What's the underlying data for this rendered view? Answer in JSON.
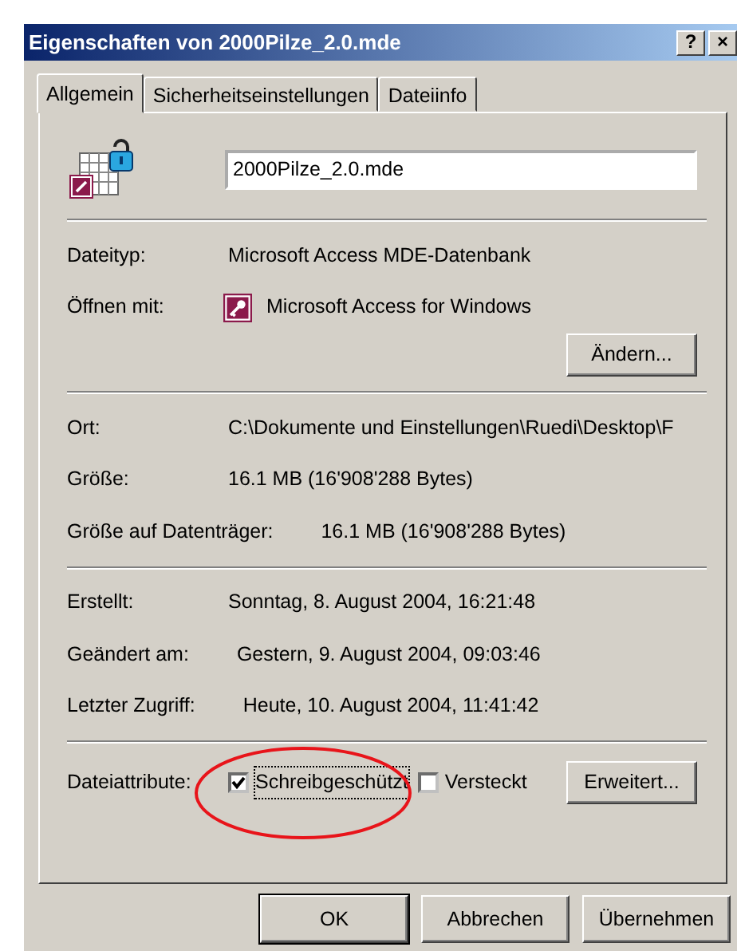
{
  "window": {
    "title": "Eigenschaften von 2000Pilze_2.0.mde",
    "buttons": [
      "?",
      "×"
    ]
  },
  "tabs": [
    {
      "label": "Allgemein",
      "selected": true
    },
    {
      "label": "Sicherheitseinstellungen",
      "selected": false
    },
    {
      "label": "Dateiinfo",
      "selected": false
    }
  ],
  "file_name": "2000Pilze_2.0.mde",
  "sections": [
    {
      "rows": [
        {
          "kind": "text",
          "label": "Dateityp:",
          "value": "Microsoft Access MDE-Datenbank"
        },
        {
          "kind": "app",
          "label": "Öffnen mit:",
          "value": "Microsoft Access for Windows"
        }
      ],
      "button": "Ändern..."
    },
    {
      "rows": [
        {
          "kind": "text",
          "label": "Ort:",
          "value": "C:\\Dokumente und Einstellungen\\Ruedi\\Desktop\\F"
        },
        {
          "kind": "text",
          "label": "Größe:",
          "value": "16.1 MB (16'908'288 Bytes)"
        },
        {
          "kind": "text",
          "label": "Größe auf Datenträger:",
          "value": "16.1 MB (16'908'288 Bytes)"
        }
      ]
    },
    {
      "rows": [
        {
          "kind": "text",
          "label": "Erstellt:",
          "value": "Sonntag, 8. August 2004, 16:21:48"
        },
        {
          "kind": "text",
          "label": "Geändert am:",
          "value": "Gestern, 9. August 2004, 09:03:46"
        },
        {
          "kind": "text",
          "label": "Letzter Zugriff:",
          "value": "Heute, 10. August 2004, 11:41:42"
        }
      ]
    }
  ],
  "attributes": {
    "label": "Dateiattribute:",
    "options": [
      {
        "label": "Schreibgeschützt",
        "checked": true,
        "highlighted": true
      },
      {
        "label": "Versteckt",
        "checked": false,
        "highlighted": false
      }
    ],
    "button": "Erweitert..."
  },
  "footer_buttons": [
    {
      "label": "OK",
      "default": true
    },
    {
      "label": "Abbrechen",
      "default": false
    },
    {
      "label": "Übernehmen",
      "default": false
    }
  ]
}
